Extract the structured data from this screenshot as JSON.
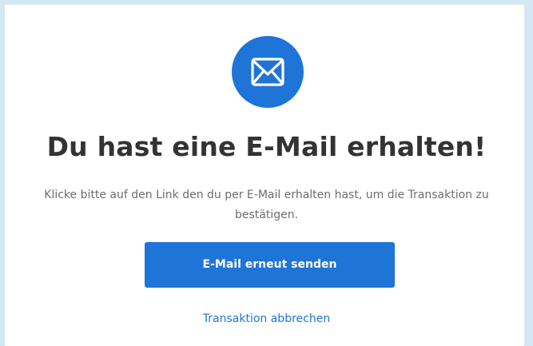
{
  "icon": {
    "name": "mail-envelope-icon",
    "background": "#1f74d7",
    "color": "#ffffff"
  },
  "title": "Du hast eine E-Mail erhalten!",
  "description": "Klicke bitte auf den Link den du per E-Mail erhalten hast, um die Transaktion zu bestätigen.",
  "actions": {
    "resend_label": "E-Mail erneut senden",
    "cancel_label": "Transaktion abbrechen"
  },
  "colors": {
    "accent": "#1f74d7",
    "title_text": "#333333",
    "body_text": "#6d6d6d",
    "page_background": "#d6e7f4",
    "card_background": "#ffffff"
  }
}
